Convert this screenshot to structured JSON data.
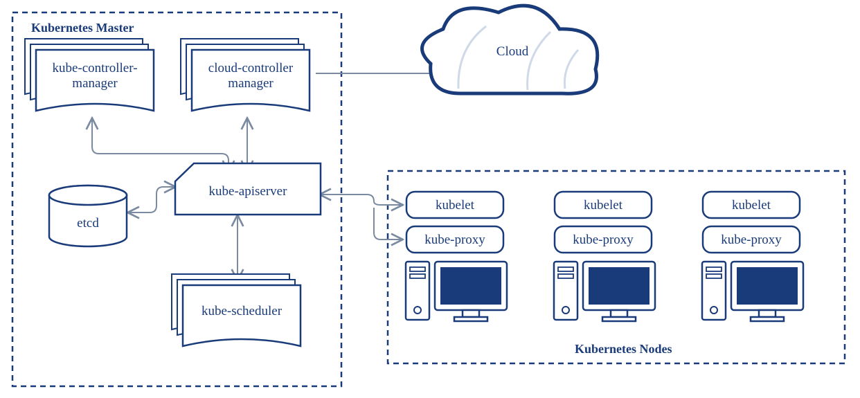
{
  "colors": {
    "navy": "#1a3b7a",
    "line": "#7a8aa0",
    "white": "#ffffff",
    "cloudFill": "#eef3fa"
  },
  "master": {
    "title": "Kubernetes Master",
    "kcm": "kube-controller-\nmanager",
    "ccm": "cloud-controller\nmanager",
    "api": "kube-apiserver",
    "etcd": "etcd",
    "sched": "kube-scheduler"
  },
  "nodes": {
    "title": "Kubernetes Nodes",
    "items": [
      {
        "kubelet": "kubelet",
        "proxy": "kube-proxy"
      },
      {
        "kubelet": "kubelet",
        "proxy": "kube-proxy"
      },
      {
        "kubelet": "kubelet",
        "proxy": "kube-proxy"
      }
    ]
  },
  "cloud": {
    "label": "Cloud"
  }
}
